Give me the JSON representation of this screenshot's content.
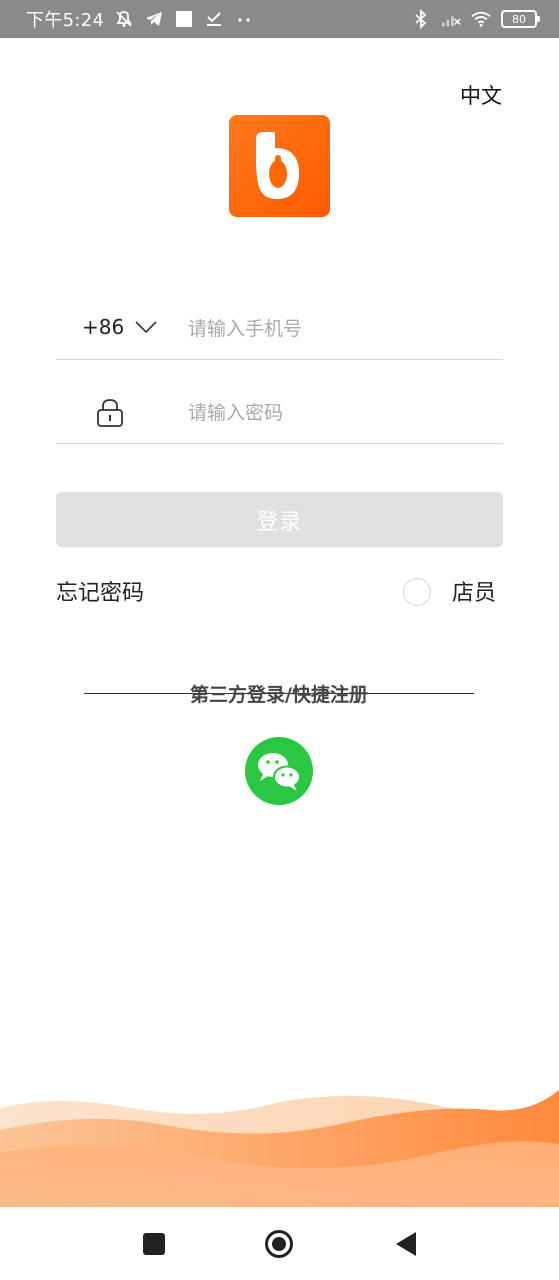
{
  "status_bar": {
    "time": "下午5:24",
    "battery": "80",
    "icons": [
      "mute-alarm-icon",
      "telegram-icon",
      "square-icon",
      "checkmark-icon",
      "more-dots-icon",
      "bluetooth-icon",
      "signal-icon",
      "wifi-icon",
      "battery-icon"
    ]
  },
  "header": {
    "language": "中文"
  },
  "logo": {
    "icon": "app-logo-icon",
    "color": "#ff6a00"
  },
  "login_form": {
    "country_code": "+86",
    "phone_placeholder": "请输入手机号",
    "password_placeholder": "请输入密码",
    "login_label": "登录",
    "forgot_password": "忘记密码",
    "clerk_label": "店员"
  },
  "third_party": {
    "label": "第三方登录/快捷注册",
    "wechat_icon": "wechat-icon",
    "wechat_color": "#2bc742"
  },
  "nav_bar": {
    "buttons": [
      "recent-apps-icon",
      "home-icon",
      "back-icon"
    ]
  },
  "colors": {
    "accent": "#ff6a00",
    "button_disabled": "#e0e0e0",
    "placeholder": "#a9a9a9"
  }
}
